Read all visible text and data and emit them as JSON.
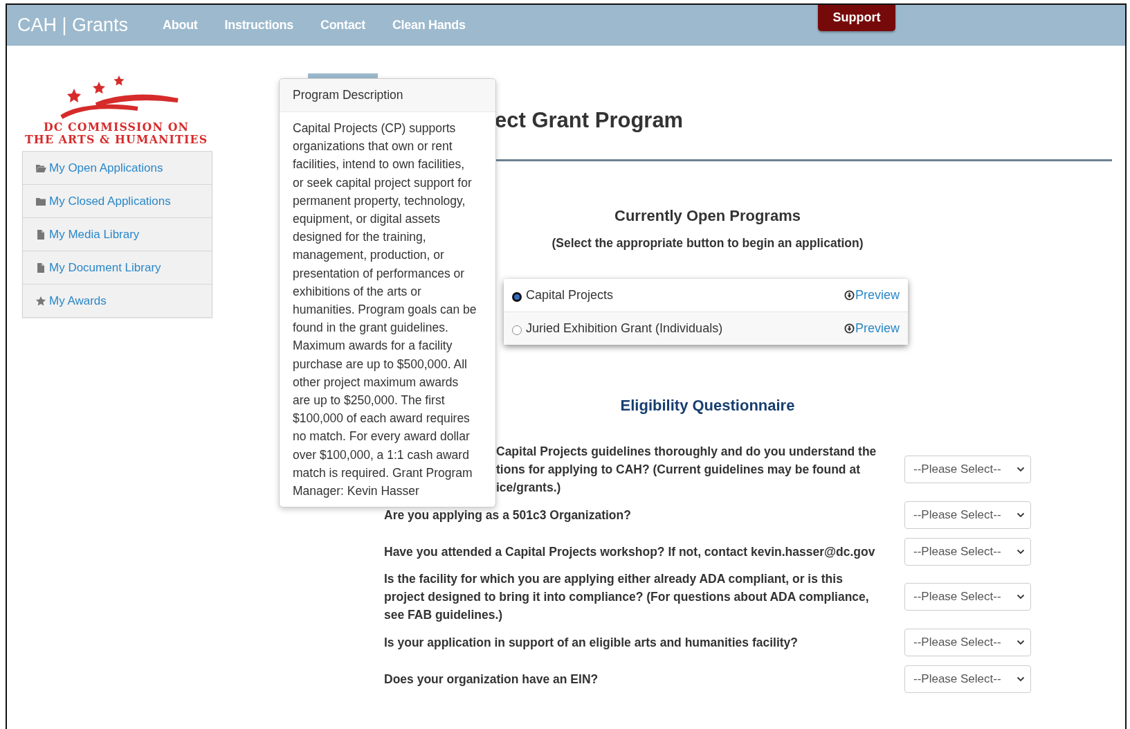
{
  "header": {
    "brand": "CAH | Grants",
    "nav": [
      "About",
      "Instructions",
      "Contact",
      "Clean Hands"
    ],
    "support": "Support"
  },
  "logo": {
    "lines": [
      "DC COMMISSION ON",
      "THE ARTS & HUMANITIES"
    ]
  },
  "sidebar": {
    "items": [
      {
        "label": "My Open Applications"
      },
      {
        "label": "My Closed Applications"
      },
      {
        "label": "My Media Library"
      },
      {
        "label": "My Document Library"
      },
      {
        "label": "My Awards"
      }
    ]
  },
  "page_title": "ect Grant Program",
  "popover": {
    "title": "Program Description",
    "body": "Capital Projects (CP) supports organizations that own or rent facilities, intend to own facilities, or seek capital project support for permanent property, technology, equipment, or digital assets designed for the training, management, production, or presentation of performances or exhibitions of the arts or humanities. Program goals can be found in the grant guidelines. Maximum awards for a facility purchase are up to $500,000. All other project maximum awards are up to $250,000. The first $100,000 of each award requires no match. For every award dollar over $100,000, a 1:1 cash award match is required. Grant Program Manager: Kevin Hasser"
  },
  "programs": {
    "heading": "Currently Open Programs",
    "subheading": "(Select the appropriate button to begin an application)",
    "items": [
      {
        "name": "Capital Projects",
        "selected": true,
        "link": "Preview"
      },
      {
        "name": "Juried Exhibition Grant (Individuals)",
        "selected": false,
        "link": "Preview"
      }
    ]
  },
  "questionnaire": {
    "heading": "Eligibility Questionnaire",
    "questions": [
      {
        "lines": [
          "Capital Projects guidelines thoroughly and do you understand the",
          "tions for applying to CAH? (Current guidelines may be found at",
          "ice/grants.)"
        ],
        "partly_covered": true,
        "answer": "--Please Select--"
      },
      {
        "lines": [
          "Are you applying as a 501c3 Organization?"
        ],
        "partly_covered": false,
        "answer": "--Please Select--"
      },
      {
        "lines": [
          "Have you attended a Capital Projects workshop? If not, contact kevin.hasser@dc.gov"
        ],
        "partly_covered": false,
        "answer": "--Please Select--"
      },
      {
        "lines": [
          "Is the facility for which you are applying either already ADA compliant, or is this",
          "project designed to bring it into compliance? (For questions about ADA compliance,",
          "see FAB guidelines.)"
        ],
        "partly_covered": false,
        "answer": "--Please Select--"
      },
      {
        "lines": [
          "Is your application in support of an eligible arts and humanities facility?"
        ],
        "partly_covered": false,
        "answer": "--Please Select--"
      },
      {
        "lines": [
          "Does your organization have an EIN?"
        ],
        "partly_covered": false,
        "answer": "--Please Select--"
      }
    ]
  }
}
